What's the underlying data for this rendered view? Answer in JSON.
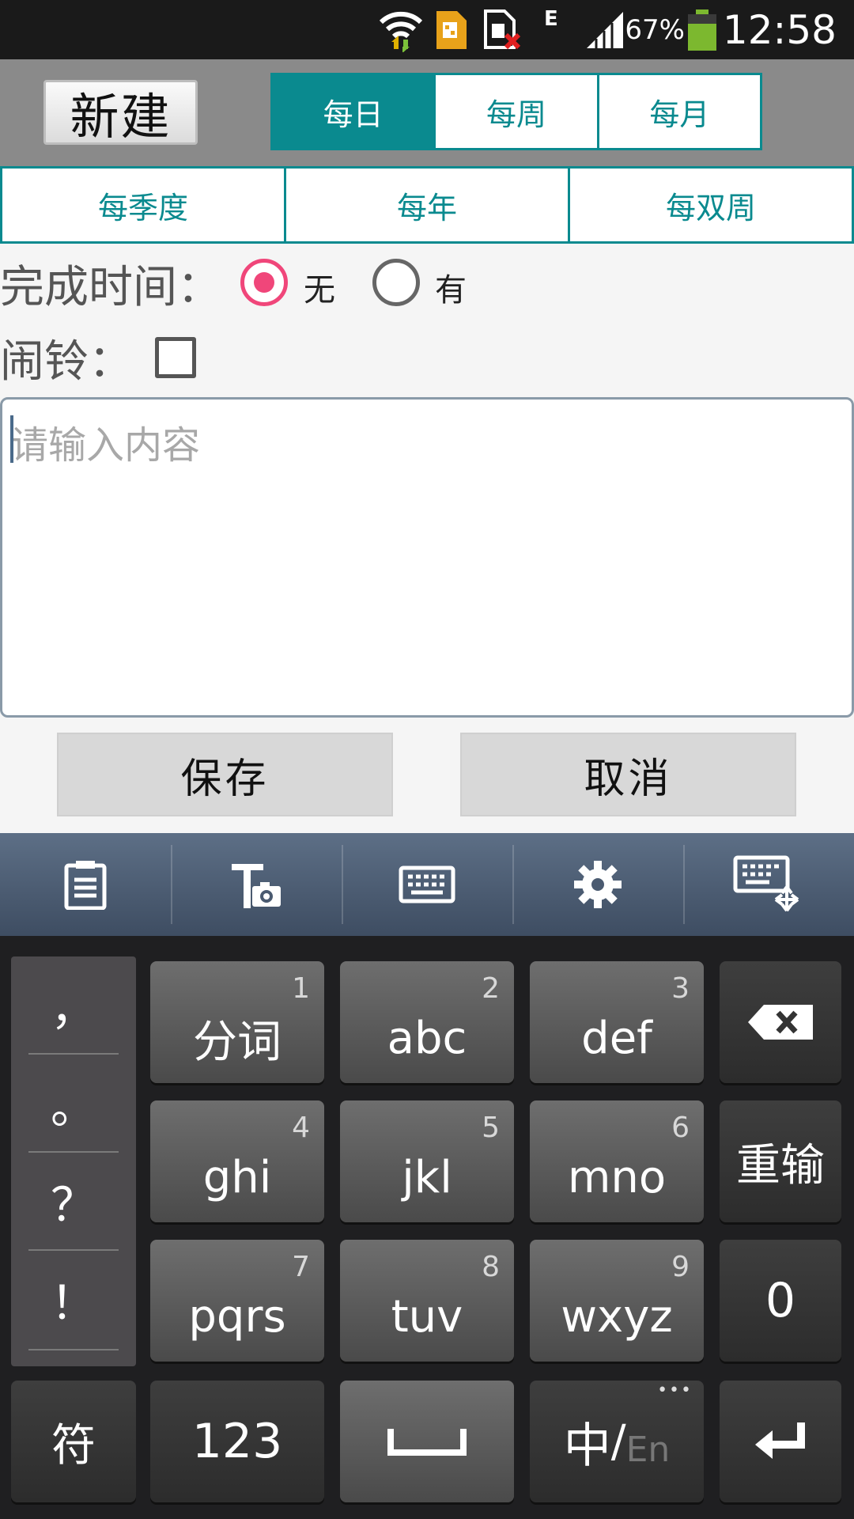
{
  "status_bar": {
    "battery_percent": "67%",
    "time": "12:58",
    "network_type": "E",
    "icons": [
      "wifi-icon",
      "sim-card-icon",
      "no-sim-icon",
      "signal-icon",
      "battery-icon"
    ]
  },
  "toolbar": {
    "new_label": "新建"
  },
  "period_tabs_row1": [
    {
      "label": "每日",
      "active": true
    },
    {
      "label": "每周",
      "active": false
    },
    {
      "label": "每月",
      "active": false
    }
  ],
  "period_tabs_row2": [
    {
      "label": "每季度"
    },
    {
      "label": "每年"
    },
    {
      "label": "每双周"
    }
  ],
  "completion_time": {
    "label": "完成时间：",
    "options": [
      {
        "label": "无",
        "checked": true
      },
      {
        "label": "有",
        "checked": false
      }
    ]
  },
  "alarm": {
    "label": "闹铃：",
    "checked": false
  },
  "content_input": {
    "placeholder": "请输入内容",
    "value": ""
  },
  "actions": {
    "save_label": "保存",
    "cancel_label": "取消"
  },
  "keyboard": {
    "toolbar_icons": [
      "clipboard-icon",
      "text-camera-icon",
      "keyboard-icon",
      "settings-gear-icon",
      "keyboard-resize-icon"
    ],
    "punctuation": [
      "，",
      "。",
      "？",
      "！"
    ],
    "keys_row1": [
      {
        "num": "1",
        "label": "分词"
      },
      {
        "num": "2",
        "label": "abc"
      },
      {
        "num": "3",
        "label": "def"
      }
    ],
    "keys_row2": [
      {
        "num": "4",
        "label": "ghi"
      },
      {
        "num": "5",
        "label": "jkl"
      },
      {
        "num": "6",
        "label": "mno"
      }
    ],
    "keys_row3": [
      {
        "num": "7",
        "label": "pqrs"
      },
      {
        "num": "8",
        "label": "tuv"
      },
      {
        "num": "9",
        "label": "wxyz"
      }
    ],
    "reinput_label": "重输",
    "zero_label": "0",
    "symbol_label": "符",
    "numbers_label": "123",
    "lang_primary": "中",
    "lang_secondary": "En",
    "lang_separator": "/",
    "more_dots": "•••"
  },
  "colors": {
    "accent": "#0a8a8f",
    "radio_checked": "#f0467a",
    "topbar_bg": "#8a8a8a"
  }
}
